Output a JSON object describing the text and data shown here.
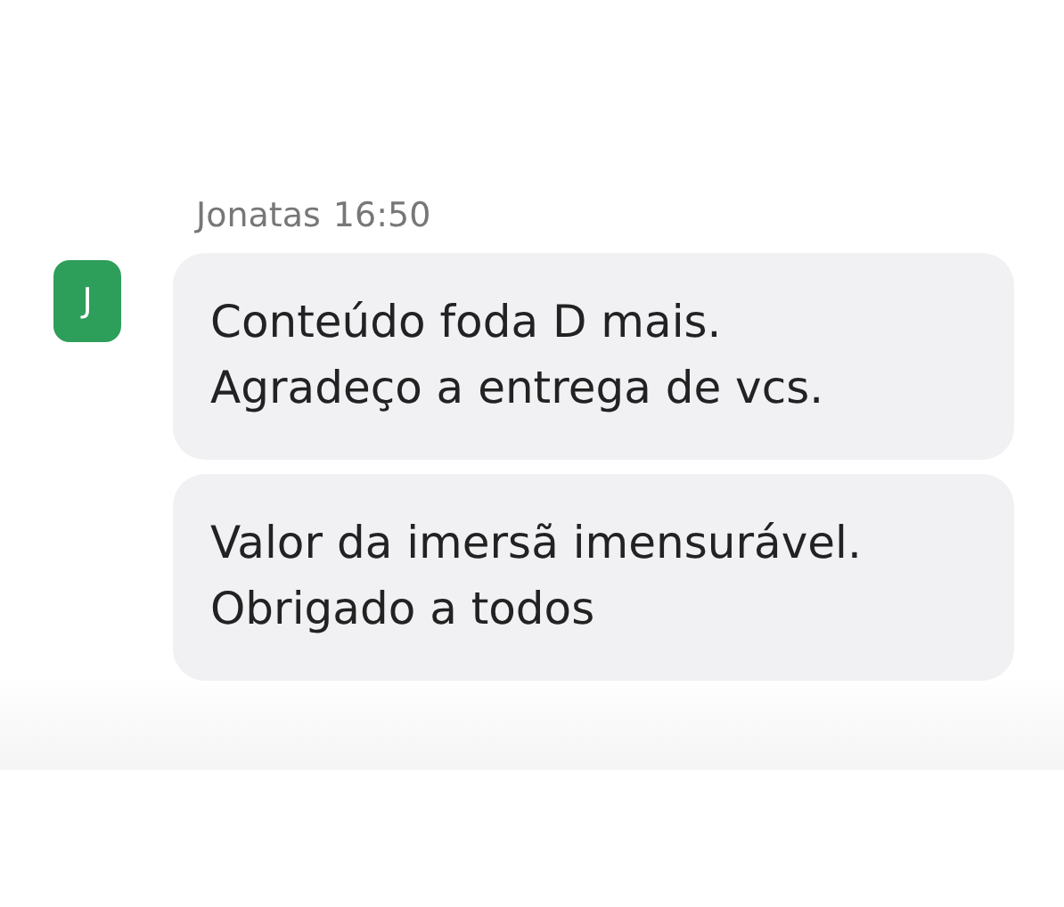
{
  "message_group": {
    "sender": "Jonatas",
    "time": "16:50",
    "avatar_letter": "J",
    "messages": [
      {
        "lines": [
          "Conteúdo foda D mais.",
          "Agradeço a entrega de vcs."
        ]
      },
      {
        "lines": [
          "Valor da imersã imensurável.",
          "Obrigado a todos"
        ]
      }
    ]
  }
}
